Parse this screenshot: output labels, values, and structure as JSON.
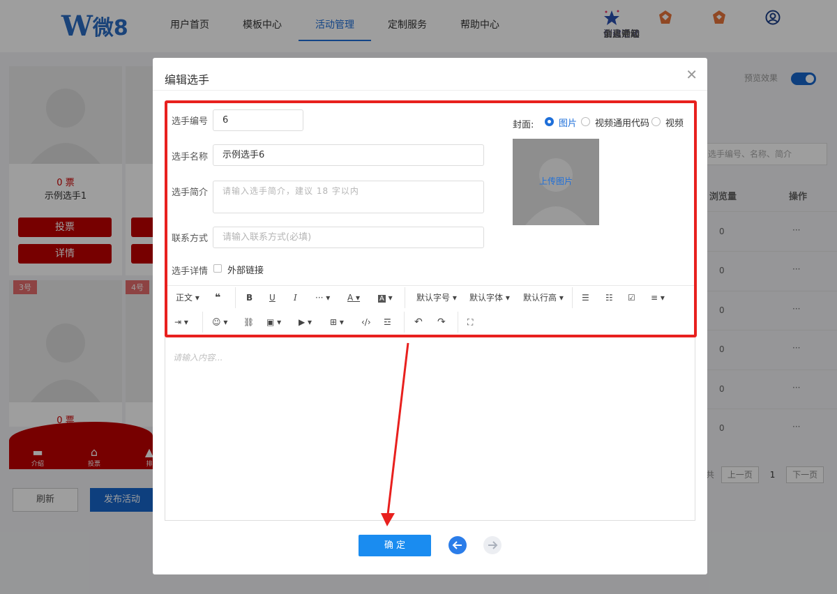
{
  "header": {
    "logo_text": "微8",
    "nav": [
      "用户首页",
      "模板中心",
      "活动管理",
      "定制服务",
      "帮助中心"
    ],
    "active_nav": "活动管理",
    "tools": [
      {
        "label": "创建活动",
        "icon": "star-icon"
      },
      {
        "label": "会员升级",
        "icon": "crown-icon"
      },
      {
        "label": "消息通知",
        "icon": "bell-icon"
      },
      {
        "label": "个人中心",
        "icon": "user-icon"
      }
    ]
  },
  "background": {
    "cards": [
      {
        "votes": "0 票",
        "name": "示例选手1",
        "vote_btn": "投票",
        "detail_btn": "详情"
      }
    ],
    "tags": [
      "3号",
      "4号"
    ],
    "card2_votes": "0 票",
    "tabbar": [
      "介绍",
      "投票",
      "排"
    ],
    "refresh": "刷新",
    "publish": "发布活动",
    "preview_label": "预览效果",
    "search_placeholder": "选手编号、名称、简介",
    "columns": [
      "浏览量",
      "操作"
    ],
    "rows": [
      {
        "views": "0",
        "ops": "···"
      },
      {
        "views": "0",
        "ops": "···"
      },
      {
        "views": "0",
        "ops": "···"
      },
      {
        "views": "0",
        "ops": "···"
      },
      {
        "views": "0",
        "ops": "···"
      },
      {
        "views": "0",
        "ops": "···"
      }
    ],
    "pager": {
      "prefix": "共",
      "prev": "上一页",
      "page": "1",
      "next": "下一页"
    }
  },
  "modal": {
    "title": "编辑选手",
    "fields": {
      "number_label": "选手编号",
      "number_value": "6",
      "name_label": "选手名称",
      "name_value": "示例选手6",
      "intro_label": "选手简介",
      "intro_placeholder": "请输入选手简介，建议 18 字以内",
      "contact_label": "联系方式",
      "contact_placeholder": "请输入联系方式(必填)",
      "detail_label": "选手详情",
      "external_link": "外部链接"
    },
    "cover": {
      "label": "封面:",
      "options": [
        "图片",
        "视频通用代码",
        "视频"
      ],
      "selected": "图片",
      "upload_text": "上传图片"
    },
    "toolbar_row1": [
      "正文",
      "默认字号",
      "默认字体",
      "默认行高"
    ],
    "editor_placeholder": "请输入内容...",
    "confirm": "确 定"
  }
}
